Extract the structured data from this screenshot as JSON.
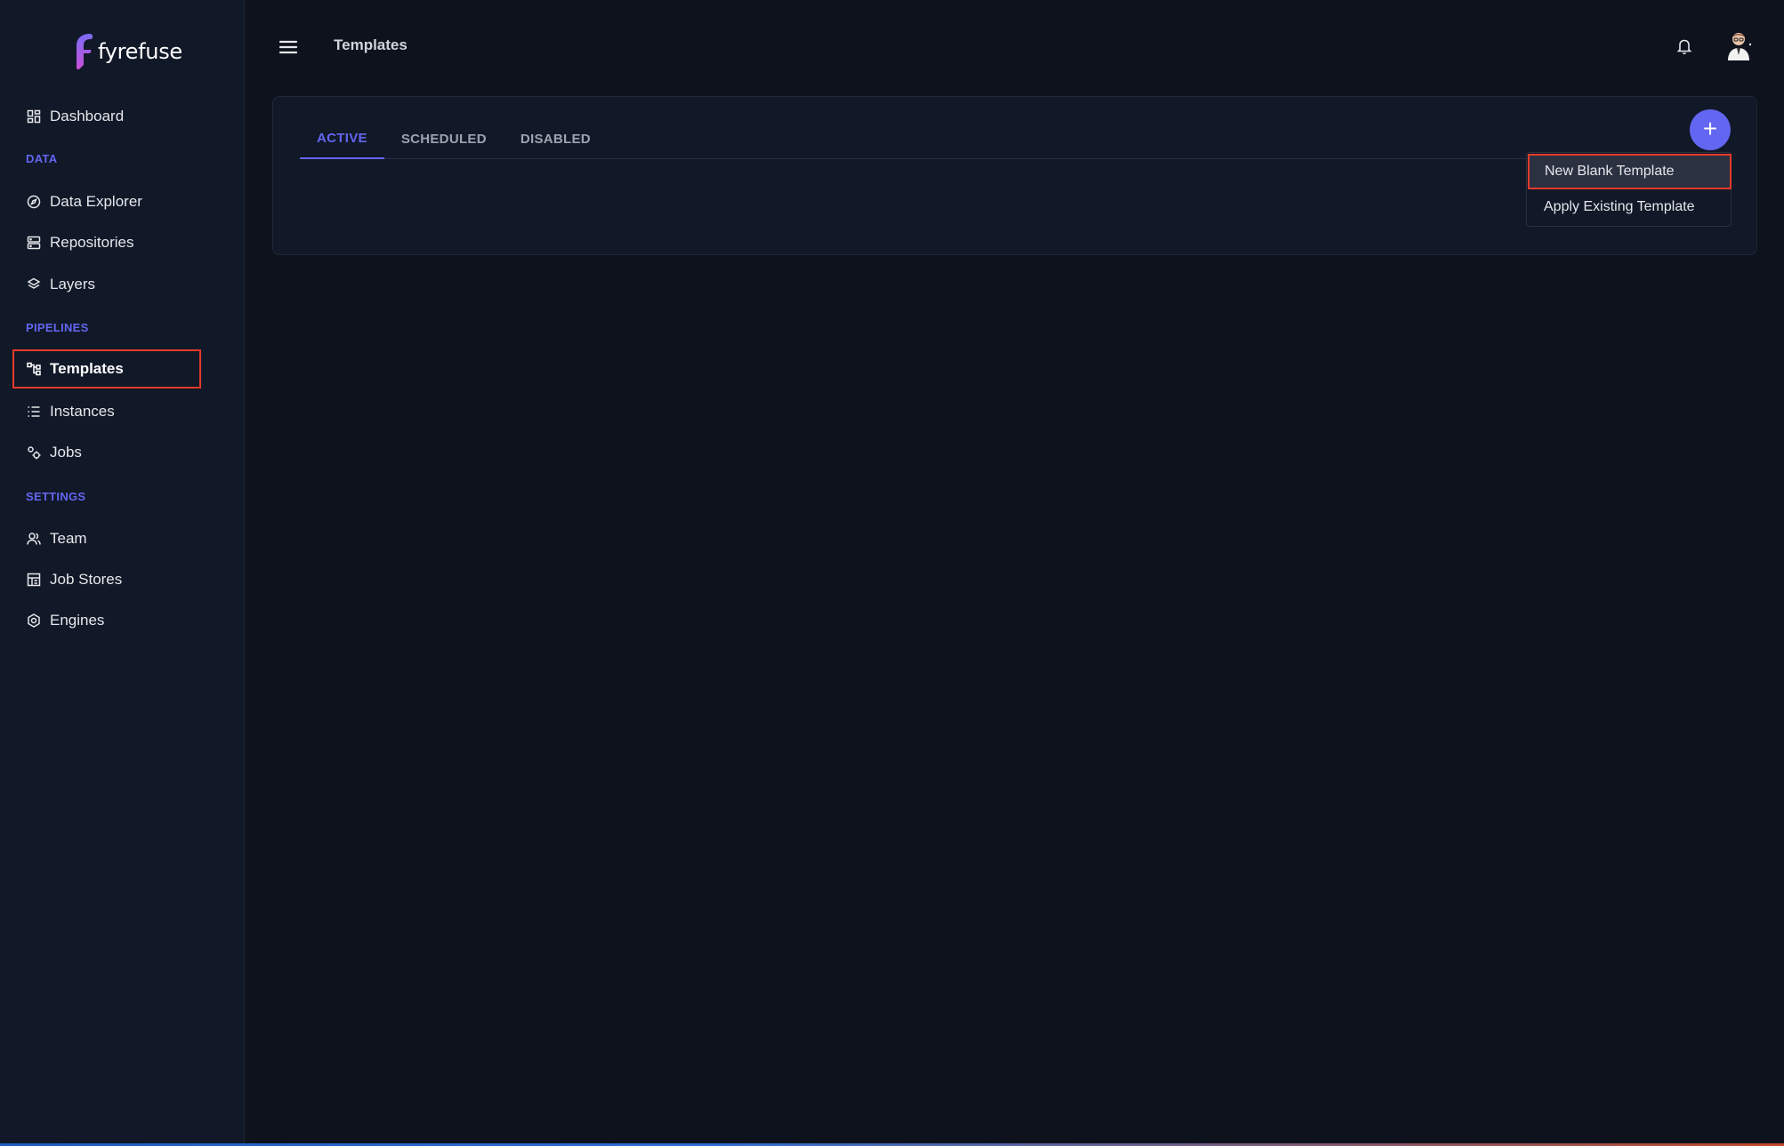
{
  "brand": {
    "name": "fyrefuse"
  },
  "sidebar": {
    "dashboard": {
      "label": "Dashboard",
      "icon": "dashboard-icon"
    },
    "sections": {
      "data": "DATA",
      "pipelines": "PIPELINES",
      "settings": "SETTINGS"
    },
    "data_items": [
      {
        "label": "Data Explorer",
        "icon": "compass-icon"
      },
      {
        "label": "Repositories",
        "icon": "server-icon"
      },
      {
        "label": "Layers",
        "icon": "layers-icon"
      }
    ],
    "pipeline_items": [
      {
        "label": "Templates",
        "icon": "flow-icon",
        "active": true
      },
      {
        "label": "Instances",
        "icon": "list-icon"
      },
      {
        "label": "Jobs",
        "icon": "gears-icon"
      }
    ],
    "settings_items": [
      {
        "label": "Team",
        "icon": "team-icon"
      },
      {
        "label": "Job Stores",
        "icon": "store-icon"
      },
      {
        "label": "Engines",
        "icon": "engine-icon"
      }
    ]
  },
  "header": {
    "title": "Templates",
    "menu_icon": "hamburger-icon",
    "bell_icon": "bell-icon"
  },
  "tabs": [
    {
      "label": "ACTIVE",
      "active": true
    },
    {
      "label": "SCHEDULED"
    },
    {
      "label": "DISABLED"
    }
  ],
  "fab": {
    "label": "+"
  },
  "dropdown": {
    "items": [
      {
        "label": "New Blank Template",
        "highlighted": true
      },
      {
        "label": "Apply Existing Template"
      }
    ]
  },
  "colors": {
    "accent": "#6366f1",
    "background": "#0e121c",
    "sidebar": "#111827",
    "highlight_border": "#e5392b"
  }
}
